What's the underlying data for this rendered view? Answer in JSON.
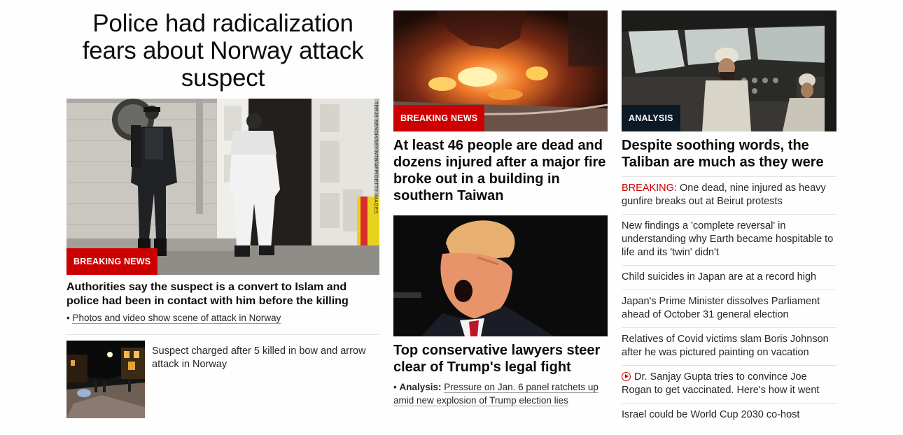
{
  "lead": {
    "title": "Police had radicalization fears about Norway attack suspect",
    "image_alt": "Police officer and forensic investigator at a building entrance",
    "photo_credit": "TERJE BENDIKSBY/NTB/AFP/GETTY IMAGES",
    "badge": "BREAKING NEWS",
    "headline": "Authorities say the suspect is a convert to Islam and police had been in contact with him before the killing",
    "bullet_link": "Photos and video show scene of attack in Norway",
    "small_story": "Suspect charged after 5 killed in bow and arrow attack in Norway"
  },
  "middle": {
    "story1": {
      "badge": "BREAKING NEWS",
      "headline": "At least 46 people are dead and dozens injured after a major fire broke out in a building in southern Taiwan"
    },
    "story2": {
      "headline": "Top conservative lawyers steer clear of Trump's legal fight",
      "bullet_label": "Analysis:",
      "bullet_link": "Pressure on Jan. 6 panel ratchets up amid new explosion of Trump election lies"
    }
  },
  "right": {
    "top_story": {
      "badge": "ANALYSIS",
      "headline": "Despite soothing words, the Taliban are much as they were"
    },
    "list": [
      {
        "prefix": "BREAKING:",
        "text": "One dead, nine injured as heavy gunfire breaks out at Beirut protests"
      },
      {
        "text": "New findings a 'complete reversal' in understanding why Earth became hospitable to life and its 'twin' didn't"
      },
      {
        "text": "Child suicides in Japan are at a record high"
      },
      {
        "text": "Japan's Prime Minister dissolves Parliament ahead of October 31 general election"
      },
      {
        "text": "Relatives of Covid victims slam Boris Johnson after he was pictured painting on vacation"
      },
      {
        "icon": "play-circle-icon",
        "text": "Dr. Sanjay Gupta tries to convince Joe Rogan to get vaccinated. Here's how it went"
      },
      {
        "text": "Israel could be World Cup 2030 co-host"
      }
    ]
  },
  "colors": {
    "accent_red": "#cc0000",
    "badge_dark": "#0c1a26",
    "text": "#0c0c0c"
  }
}
